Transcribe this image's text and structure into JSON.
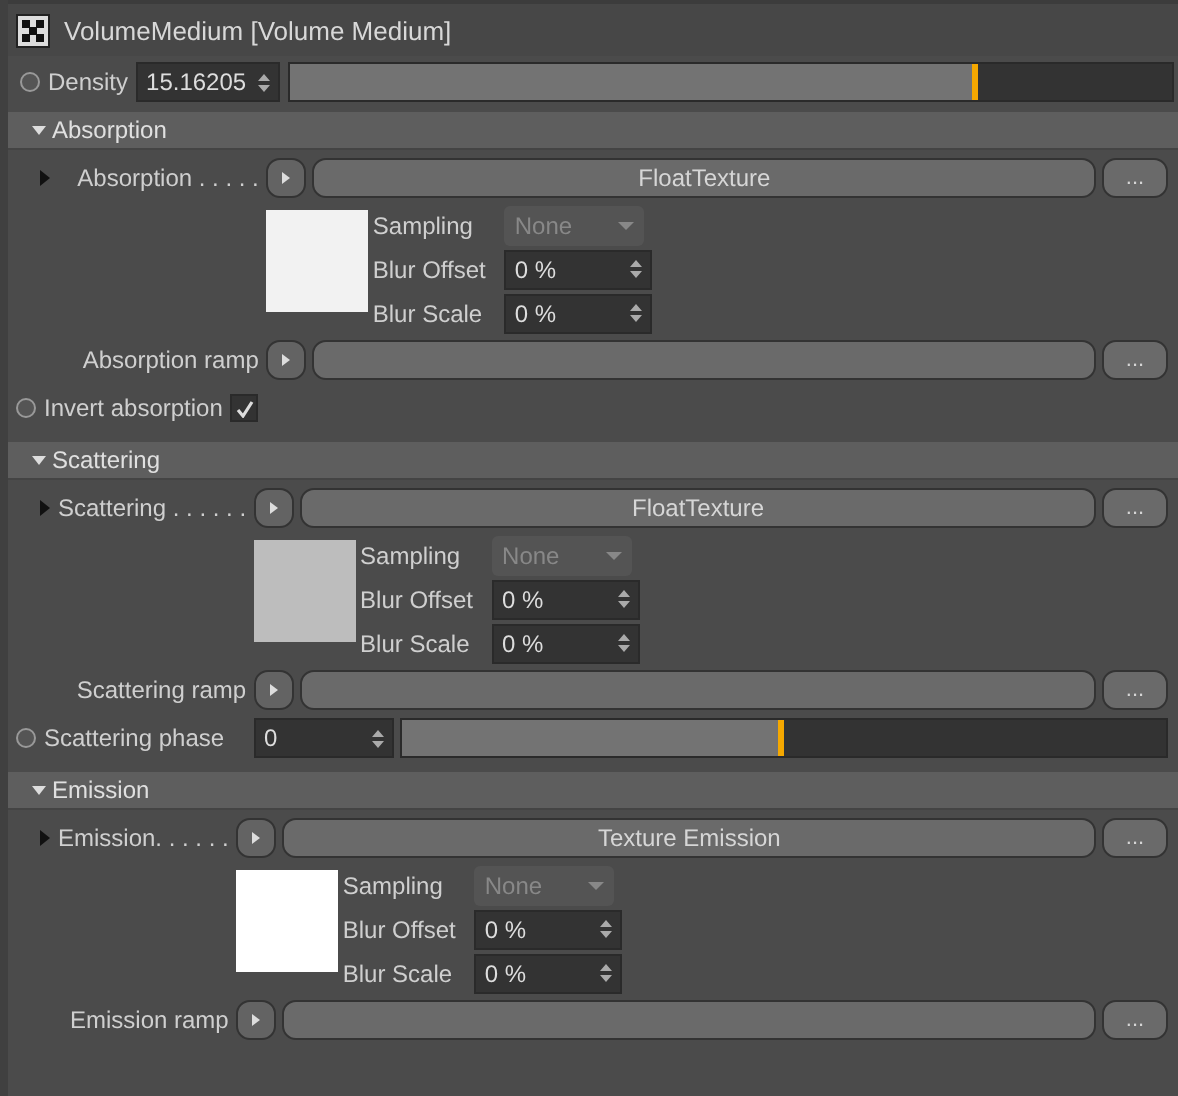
{
  "window": {
    "title": "VolumeMedium [Volume Medium]"
  },
  "density": {
    "label": "Density",
    "value": "15.16205",
    "level": 0.78,
    "animated": false
  },
  "sections": [
    {
      "title": "Absorption",
      "expanded": true,
      "rows": [
        {
          "kind": "texture",
          "label": "Absorption . . . . .",
          "expanded": false,
          "value": "FloatTexture",
          "more": "...",
          "color": "#f2f2f2",
          "fields": [
            {
              "kind": "dropdown",
              "label": "Sampling",
              "value": "None",
              "disabled": true
            },
            {
              "kind": "spinner",
              "label": "Blur Offset",
              "value": "0 %",
              "disabled": false
            },
            {
              "kind": "spinner",
              "label": "Blur Scale",
              "value": "0 %",
              "disabled": false
            }
          ]
        },
        {
          "kind": "ramp",
          "label": "Absorption ramp",
          "more": "..."
        },
        {
          "kind": "checkbox",
          "label": "Invert absorption",
          "animated": false,
          "checked": true
        }
      ]
    },
    {
      "title": "Scattering",
      "expanded": true,
      "rows": [
        {
          "kind": "texture",
          "label": "Scattering . . . . . .",
          "expanded": false,
          "value": "FloatTexture",
          "more": "...",
          "color": "#bdbdbd",
          "fields": [
            {
              "kind": "dropdown",
              "label": "Sampling",
              "value": "None",
              "disabled": true
            },
            {
              "kind": "spinner",
              "label": "Blur Offset",
              "value": "0 %",
              "disabled": false
            },
            {
              "kind": "spinner",
              "label": "Blur Scale",
              "value": "0 %",
              "disabled": false
            }
          ]
        },
        {
          "kind": "ramp",
          "label": "Scattering ramp",
          "more": "..."
        },
        {
          "kind": "slider",
          "label": "Scattering phase",
          "animated": false,
          "value": "0",
          "level": 0.5
        }
      ]
    },
    {
      "title": "Emission",
      "expanded": true,
      "rows": [
        {
          "kind": "texture",
          "label": "Emission. . . . . .",
          "expanded": false,
          "value": "Texture Emission",
          "more": "...",
          "color": "#ffffff",
          "fields": [
            {
              "kind": "dropdown",
              "label": "Sampling",
              "value": "None",
              "disabled": true
            },
            {
              "kind": "spinner",
              "label": "Blur Offset",
              "value": "0 %",
              "disabled": false
            },
            {
              "kind": "spinner",
              "label": "Blur Scale",
              "value": "0 %",
              "disabled": false
            }
          ]
        },
        {
          "kind": "ramp",
          "label": "Emission ramp",
          "more": "..."
        }
      ]
    }
  ]
}
